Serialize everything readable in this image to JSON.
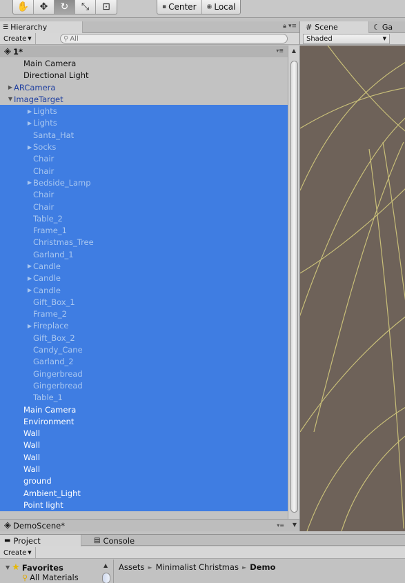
{
  "toolbar": {
    "tools": [
      "hand-icon",
      "move-icon",
      "rotate-icon",
      "scale-icon",
      "rect-icon"
    ],
    "pivot_center": "Center",
    "pivot_local": "Local"
  },
  "hierarchy": {
    "tab_label": "Hierarchy",
    "create_label": "Create",
    "search_placeholder": "All",
    "scene_name": "1*",
    "rows": [
      {
        "label": "Main Camera",
        "indent": 1,
        "selected": false,
        "arrow": false,
        "blue": false
      },
      {
        "label": "Directional Light",
        "indent": 1,
        "selected": false,
        "arrow": false,
        "blue": false
      },
      {
        "label": "ARCamera",
        "indent": 0,
        "selected": false,
        "arrow": true,
        "blue": true
      },
      {
        "label": "ImageTarget",
        "indent": 0,
        "selected": false,
        "arrow": true,
        "open": true,
        "blue": true
      },
      {
        "label": "Lights",
        "indent": 2,
        "selected": true,
        "arrow": true,
        "dim": true
      },
      {
        "label": "Lights",
        "indent": 2,
        "selected": true,
        "arrow": true,
        "dim": true
      },
      {
        "label": "Santa_Hat",
        "indent": 2,
        "selected": true,
        "arrow": false,
        "dim": true
      },
      {
        "label": "Socks",
        "indent": 2,
        "selected": true,
        "arrow": true,
        "dim": true
      },
      {
        "label": "Chair",
        "indent": 2,
        "selected": true,
        "arrow": false,
        "dim": true
      },
      {
        "label": "Chair",
        "indent": 2,
        "selected": true,
        "arrow": false,
        "dim": true
      },
      {
        "label": "Bedside_Lamp",
        "indent": 2,
        "selected": true,
        "arrow": true,
        "dim": true
      },
      {
        "label": "Chair",
        "indent": 2,
        "selected": true,
        "arrow": false,
        "dim": true
      },
      {
        "label": "Chair",
        "indent": 2,
        "selected": true,
        "arrow": false,
        "dim": true
      },
      {
        "label": "Table_2",
        "indent": 2,
        "selected": true,
        "arrow": false,
        "dim": true
      },
      {
        "label": "Frame_1",
        "indent": 2,
        "selected": true,
        "arrow": false,
        "dim": true
      },
      {
        "label": "Christmas_Tree",
        "indent": 2,
        "selected": true,
        "arrow": false,
        "dim": true
      },
      {
        "label": "Garland_1",
        "indent": 2,
        "selected": true,
        "arrow": false,
        "dim": true
      },
      {
        "label": "Candle",
        "indent": 2,
        "selected": true,
        "arrow": true,
        "dim": true
      },
      {
        "label": "Candle",
        "indent": 2,
        "selected": true,
        "arrow": true,
        "dim": true
      },
      {
        "label": "Candle",
        "indent": 2,
        "selected": true,
        "arrow": true,
        "dim": true
      },
      {
        "label": "Gift_Box_1",
        "indent": 2,
        "selected": true,
        "arrow": false,
        "dim": true
      },
      {
        "label": "Frame_2",
        "indent": 2,
        "selected": true,
        "arrow": false,
        "dim": true
      },
      {
        "label": "Fireplace",
        "indent": 2,
        "selected": true,
        "arrow": true,
        "dim": true
      },
      {
        "label": "Gift_Box_2",
        "indent": 2,
        "selected": true,
        "arrow": false,
        "dim": true
      },
      {
        "label": "Candy_Cane",
        "indent": 2,
        "selected": true,
        "arrow": false,
        "dim": true
      },
      {
        "label": "Garland_2",
        "indent": 2,
        "selected": true,
        "arrow": false,
        "dim": true
      },
      {
        "label": "Gingerbread",
        "indent": 2,
        "selected": true,
        "arrow": false,
        "dim": true
      },
      {
        "label": "Gingerbread",
        "indent": 2,
        "selected": true,
        "arrow": false,
        "dim": true
      },
      {
        "label": "Table_1",
        "indent": 2,
        "selected": true,
        "arrow": false,
        "dim": true
      },
      {
        "label": "Main Camera",
        "indent": 1,
        "selected": true,
        "arrow": false,
        "dim": false
      },
      {
        "label": "Environment",
        "indent": 1,
        "selected": true,
        "arrow": false,
        "dim": false
      },
      {
        "label": "Wall",
        "indent": 1,
        "selected": true,
        "arrow": false,
        "dim": false
      },
      {
        "label": "Wall",
        "indent": 1,
        "selected": true,
        "arrow": false,
        "dim": false
      },
      {
        "label": "Wall",
        "indent": 1,
        "selected": true,
        "arrow": false,
        "dim": false
      },
      {
        "label": "Wall",
        "indent": 1,
        "selected": true,
        "arrow": false,
        "dim": false
      },
      {
        "label": "ground",
        "indent": 1,
        "selected": true,
        "arrow": false,
        "dim": false
      },
      {
        "label": "Ambient_Light",
        "indent": 1,
        "selected": true,
        "arrow": false,
        "dim": false
      },
      {
        "label": "Point light",
        "indent": 1,
        "selected": true,
        "arrow": false,
        "dim": false
      }
    ],
    "demo_scene": "DemoScene*"
  },
  "scene": {
    "tab_label": "Scene",
    "game_tab_label": "Ga",
    "shading_mode": "Shaded"
  },
  "project": {
    "tab_label": "Project",
    "console_label": "Console",
    "create_label": "Create",
    "favorites_label": "Favorites",
    "all_materials_label": "All Materials",
    "breadcrumb": [
      "Assets",
      "Minimalist Christmas",
      "Demo"
    ]
  },
  "colors": {
    "selection": "#3f7de2",
    "scene_bg": "#6e6259",
    "gizmo_line": "#d8cf7e"
  }
}
